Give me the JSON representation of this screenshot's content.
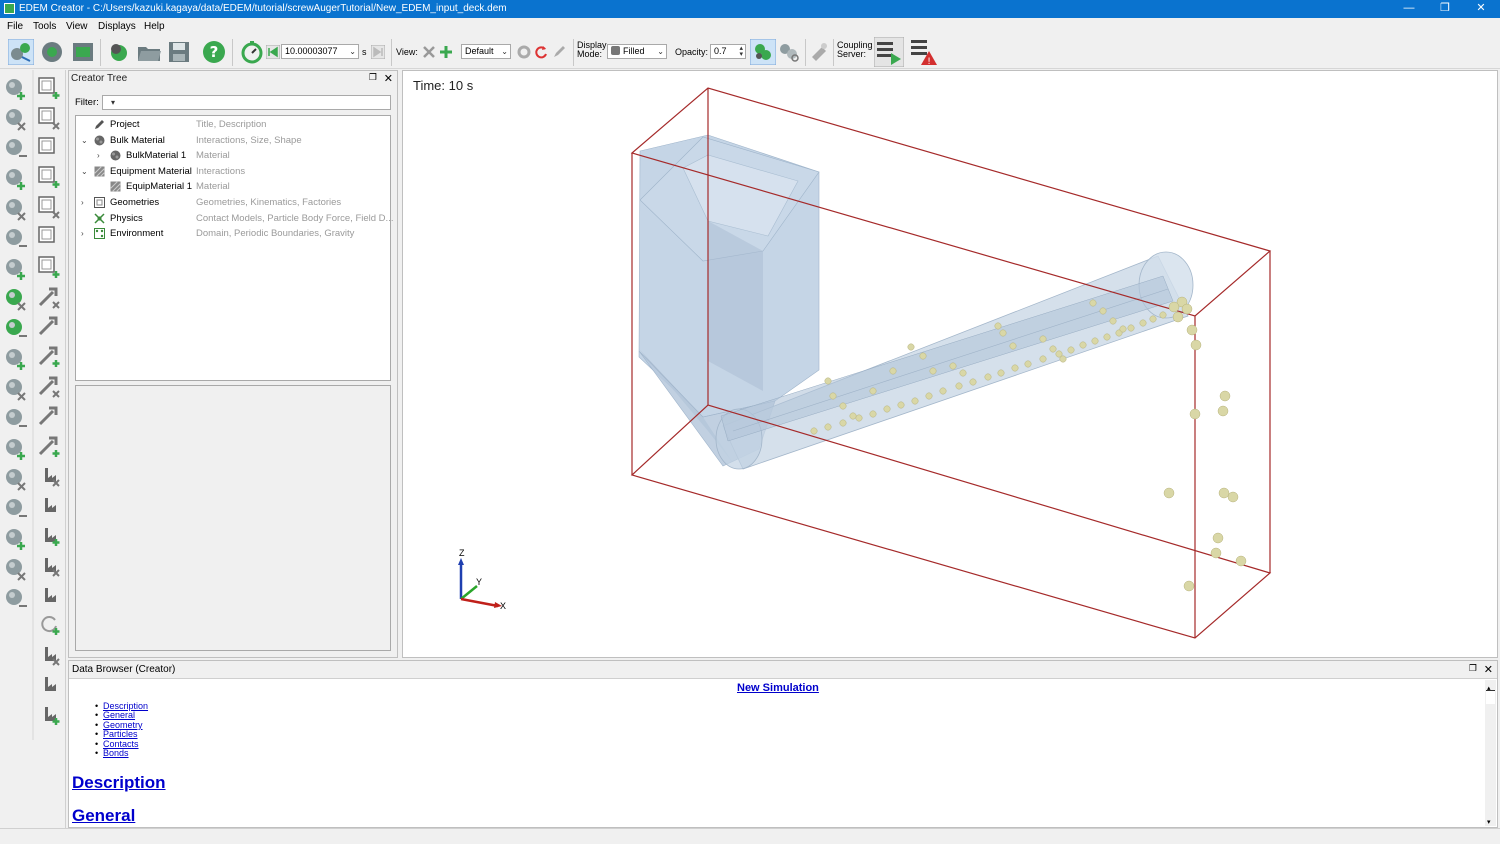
{
  "window": {
    "title": "EDEM Creator - C:/Users/kazuki.kagaya/data/EDEM/tutorial/screwAugerTutorial/New_EDEM_input_deck.dem",
    "minimize": "—",
    "maximize": "❐",
    "close": "✕"
  },
  "menu": [
    "File",
    "Tools",
    "View",
    "Displays",
    "Help"
  ],
  "toolbar": {
    "time_value": "10.00003077",
    "time_unit": "s",
    "view_label": "View:",
    "view_preset": "Default",
    "display_mode_label": "Display\nMode:",
    "display_mode_value": "Filled",
    "opacity_label": "Opacity:",
    "opacity_value": "0.7",
    "coupling_label": "Coupling\nServer:"
  },
  "creator_tree": {
    "title": "Creator Tree",
    "filter_label": "Filter:",
    "items": [
      {
        "name": "Project",
        "desc": "Title, Description",
        "level": 0,
        "expander": "",
        "icon": "pencil-icon"
      },
      {
        "name": "Bulk Material",
        "desc": "Interactions, Size, Shape",
        "level": 0,
        "expander": "v",
        "icon": "particle-icon"
      },
      {
        "name": "BulkMaterial 1",
        "desc": "Material",
        "level": 1,
        "expander": ">",
        "icon": "particle-icon"
      },
      {
        "name": "Equipment Material",
        "desc": "Interactions",
        "level": 0,
        "expander": "v",
        "icon": "hatched-square-icon"
      },
      {
        "name": "EquipMaterial 1",
        "desc": "Material",
        "level": 1,
        "expander": "",
        "icon": "hatched-square-icon"
      },
      {
        "name": "Geometries",
        "desc": "Geometries, Kinematics, Factories",
        "level": 0,
        "expander": ">",
        "icon": "box-icon"
      },
      {
        "name": "Physics",
        "desc": "Contact Models, Particle Body Force, Field D...",
        "level": 0,
        "expander": "",
        "icon": "physics-icon"
      },
      {
        "name": "Environment",
        "desc": "Domain, Periodic Boundaries, Gravity",
        "level": 0,
        "expander": ">",
        "icon": "environment-icon"
      }
    ]
  },
  "viewport": {
    "time_label": "Time: 10 s",
    "axes": {
      "z": "Z",
      "y": "Y",
      "x": "X"
    }
  },
  "data_browser": {
    "title": "Data Browser (Creator)",
    "heading": "New Simulation",
    "toc": [
      "Description",
      "General",
      "Geometry",
      "Particles",
      "Contacts",
      "Bonds"
    ],
    "sections": [
      "Description",
      "General"
    ]
  },
  "colors": {
    "titlebar": "#0a73cf",
    "domain_box": "#a52a2a",
    "geometry_fill": "#b8cbe0",
    "particle": "#d9d7a6",
    "link": "#0000cc"
  }
}
